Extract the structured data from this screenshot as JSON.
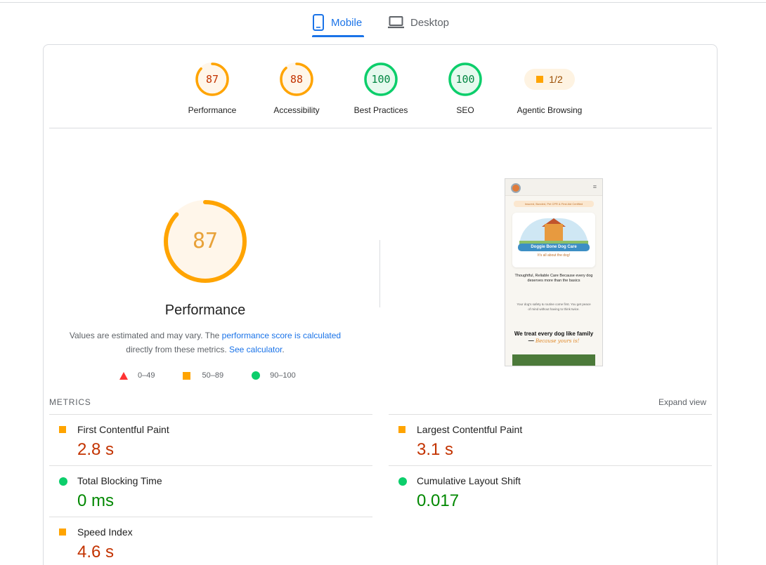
{
  "tabs": [
    {
      "label": "Mobile",
      "icon": "smartphone-icon",
      "active": true
    },
    {
      "label": "Desktop",
      "icon": "laptop-icon",
      "active": false
    }
  ],
  "scores": [
    {
      "value": "87",
      "label": "Performance",
      "score": 87,
      "status": "average"
    },
    {
      "value": "88",
      "label": "Accessibility",
      "score": 88,
      "status": "average"
    },
    {
      "value": "100",
      "label": "Best Practices",
      "score": 100,
      "status": "pass"
    },
    {
      "value": "100",
      "label": "SEO",
      "score": 100,
      "status": "pass"
    }
  ],
  "agentic": {
    "value": "1/2",
    "label": "Agentic Browsing"
  },
  "performance": {
    "score_text": "87",
    "score": 87,
    "title": "Performance",
    "note_prefix": "Values are estimated and may vary. The ",
    "note_link": "performance score is calculated",
    "note_middle": " directly from these metrics. ",
    "calculator_link": "See calculator",
    "note_suffix": "."
  },
  "legend": [
    {
      "range": "0–49",
      "shape": "triangle",
      "color": "#ff3333"
    },
    {
      "range": "50–89",
      "shape": "square",
      "color": "#ffa400"
    },
    {
      "range": "90–100",
      "shape": "circle",
      "color": "#0cce6b"
    }
  ],
  "thumbnail": {
    "badge": "Insured, Bonded, Pet CPR & First Aid Certified",
    "brand": "Doggie Bone Dog Care",
    "tagline": "It's all about the dog!",
    "heading": "Thoughtful, Reliable Care Because every dog deserves more than the basics",
    "body": "Your dog's safety & routine come first. You get peace of mind without having to think twice.",
    "headline": "We treat every dog like family —",
    "headline_em": "Because yours is!",
    "menu": "≡"
  },
  "metrics": {
    "header": "METRICS",
    "expand": "Expand view",
    "items": [
      {
        "name": "First Contentful Paint",
        "value": "2.8 s",
        "status": "average"
      },
      {
        "name": "Largest Contentful Paint",
        "value": "3.1 s",
        "status": "average"
      },
      {
        "name": "Total Blocking Time",
        "value": "0 ms",
        "status": "pass"
      },
      {
        "name": "Cumulative Layout Shift",
        "value": "0.017",
        "status": "pass"
      },
      {
        "name": "Speed Index",
        "value": "4.6 s",
        "status": "average"
      }
    ]
  },
  "colors": {
    "accent": "#1a73e8",
    "average": "#ffa400",
    "average_text": "#c33300",
    "pass": "#0cce6b",
    "pass_text": "#008800",
    "fail": "#ff3333"
  }
}
